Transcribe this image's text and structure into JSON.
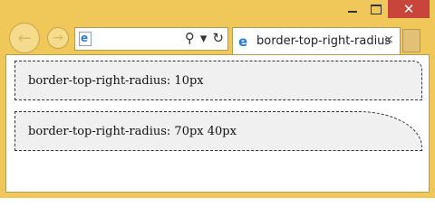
{
  "browser": {
    "tab": {
      "title": "border-top-right-radius",
      "close_glyph": "×"
    },
    "address_bar": {
      "search_glyph": "⚲",
      "dropdown_glyph": "▾",
      "refresh_glyph": "↻"
    },
    "nav": {
      "back_glyph": "←",
      "forward_glyph": "→"
    },
    "window_controls": {
      "close_glyph": "✕"
    },
    "colors": {
      "frame": "#f0c85a",
      "close": "#c7453a"
    }
  },
  "page": {
    "boxes": [
      {
        "text": "border-top-right-radius: 10px"
      },
      {
        "text": "border-top-right-radius: 70px 40px"
      }
    ]
  }
}
